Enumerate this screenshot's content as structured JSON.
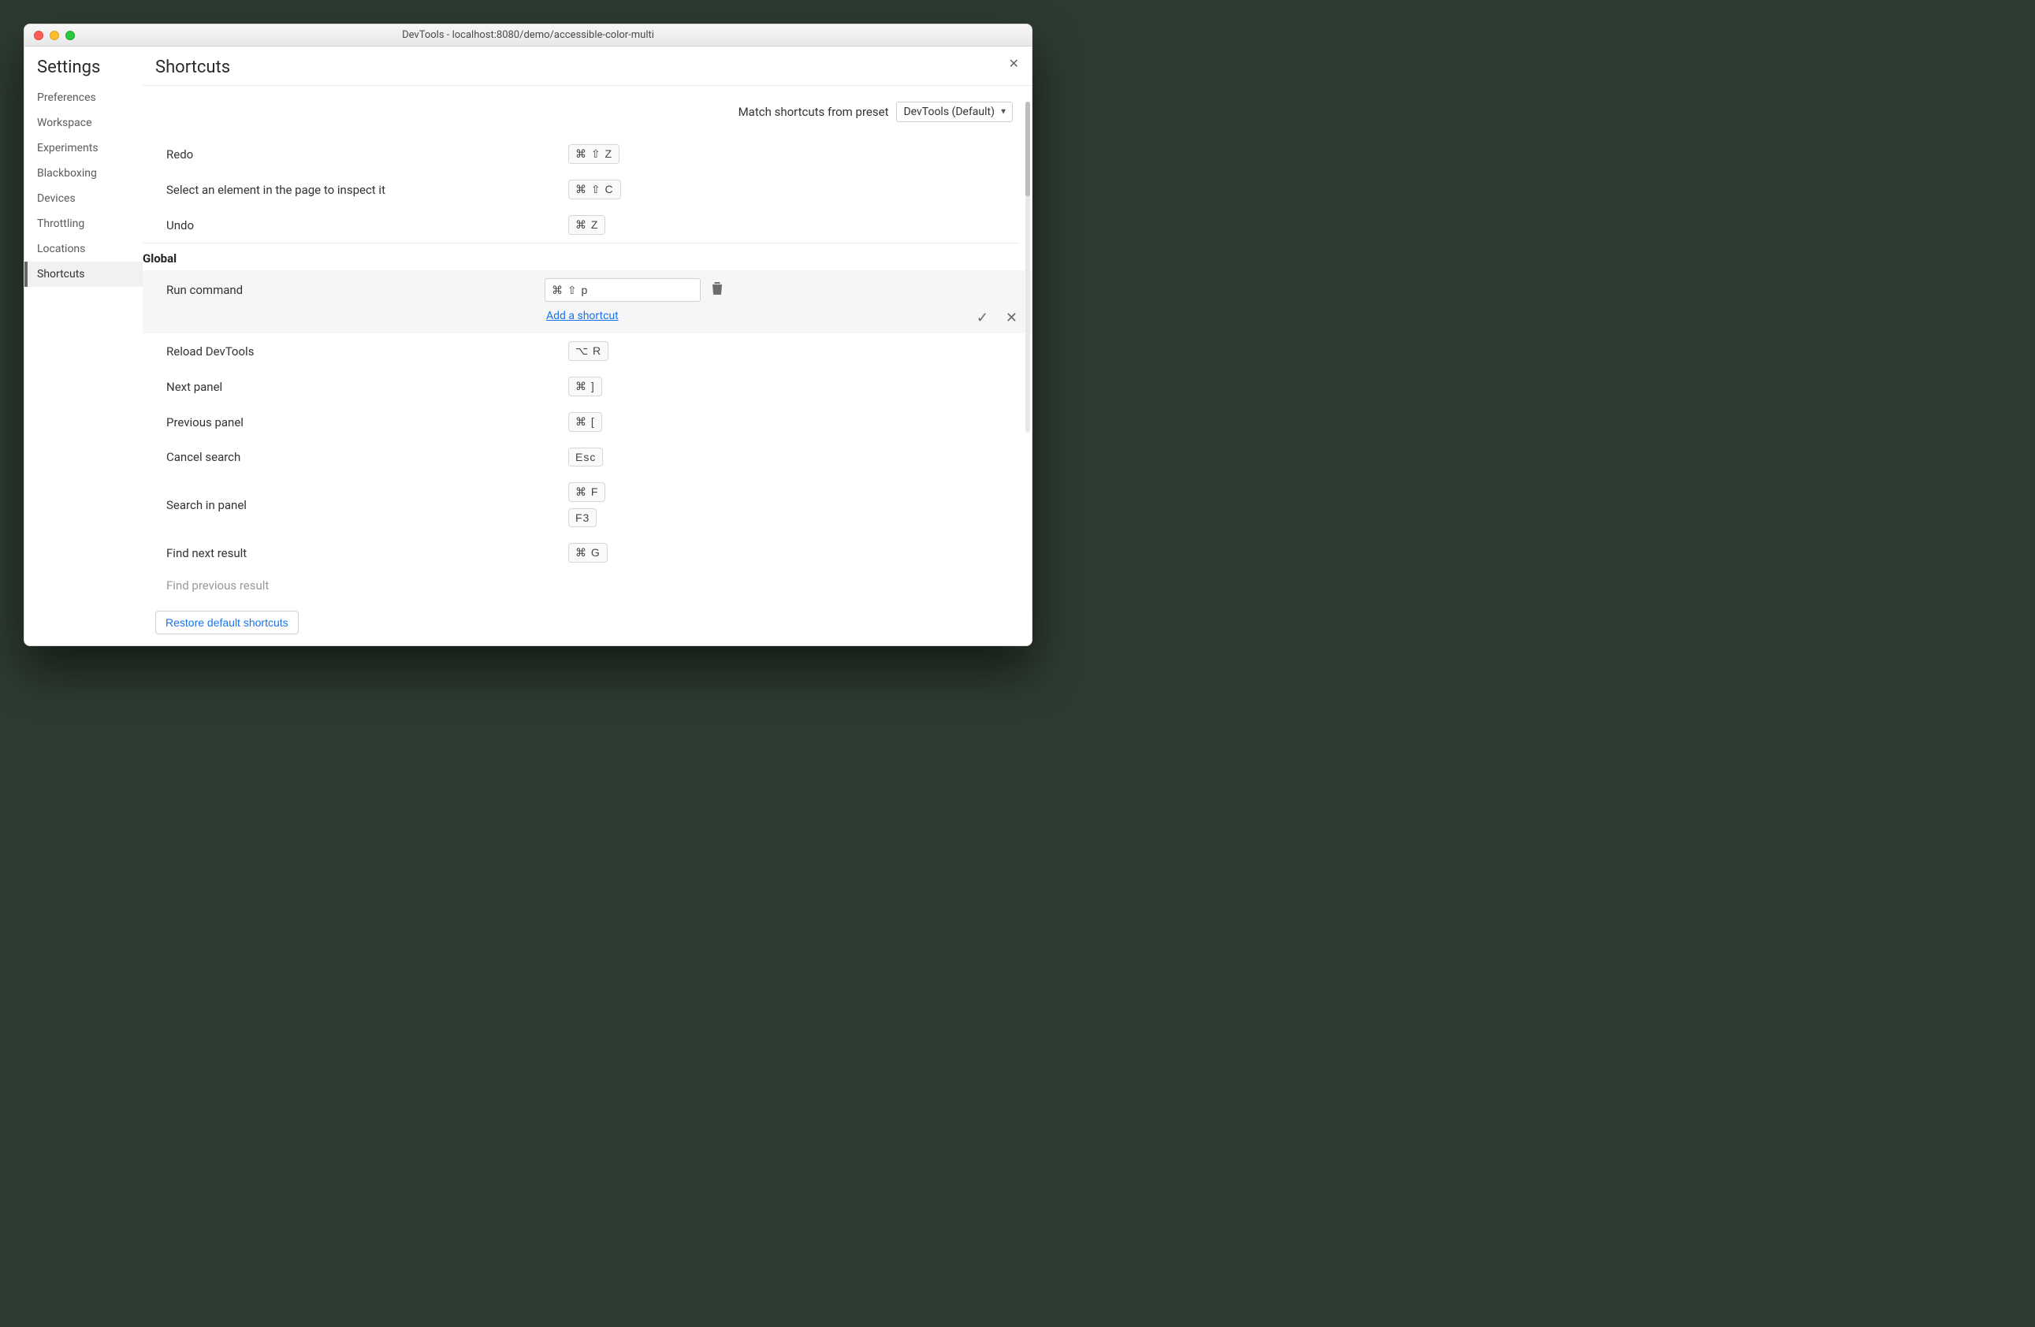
{
  "window": {
    "title": "DevTools - localhost:8080/demo/accessible-color-multi"
  },
  "sidebar": {
    "title": "Settings",
    "items": [
      "Preferences",
      "Workspace",
      "Experiments",
      "Blackboxing",
      "Devices",
      "Throttling",
      "Locations",
      "Shortcuts"
    ],
    "active_index": 7
  },
  "pane": {
    "title": "Shortcuts",
    "close_glyph": "✕",
    "preset_label": "Match shortcuts from preset",
    "preset_value": "DevTools (Default)"
  },
  "top_rows": [
    {
      "label": "Redo",
      "keys": [
        "⌘ ⇧ Z"
      ]
    },
    {
      "label": "Select an element in the page to inspect it",
      "keys": [
        "⌘ ⇧ C"
      ]
    },
    {
      "label": "Undo",
      "keys": [
        "⌘ Z"
      ]
    }
  ],
  "section": {
    "title": "Global"
  },
  "editing": {
    "label": "Run command",
    "input_value": "⌘ ⇧ p",
    "add_link": "Add a shortcut",
    "confirm_glyph": "✓",
    "cancel_glyph": "✕"
  },
  "global_rows": [
    {
      "label": "Reload DevTools",
      "keys": [
        "⌥ R"
      ]
    },
    {
      "label": "Next panel",
      "keys": [
        "⌘ ]"
      ]
    },
    {
      "label": "Previous panel",
      "keys": [
        "⌘ ["
      ]
    },
    {
      "label": "Cancel search",
      "keys": [
        "Esc"
      ]
    },
    {
      "label": "Search in panel",
      "keys": [
        "⌘ F",
        "F3"
      ]
    },
    {
      "label": "Find next result",
      "keys": [
        "⌘ G"
      ]
    },
    {
      "label": "Find previous result",
      "keys": []
    }
  ],
  "footer": {
    "restore": "Restore default shortcuts"
  }
}
